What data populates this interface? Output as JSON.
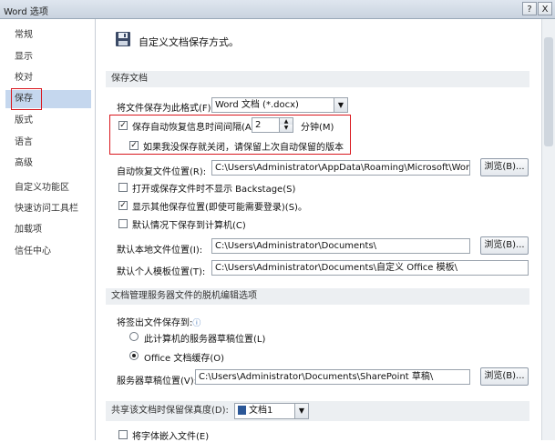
{
  "window": {
    "title": "Word 选项",
    "help_label": "?",
    "close_label": "X"
  },
  "sidebar": {
    "items": [
      {
        "label": "常规"
      },
      {
        "label": "显示"
      },
      {
        "label": "校对"
      },
      {
        "label": "保存"
      },
      {
        "label": "版式"
      },
      {
        "label": "语言"
      },
      {
        "label": "高级"
      },
      {
        "label": "自定义功能区"
      },
      {
        "label": "快速访问工具栏"
      },
      {
        "label": "加载项"
      },
      {
        "label": "信任中心"
      }
    ],
    "active": "保存"
  },
  "header": {
    "title": "自定义文档保存方式。"
  },
  "save_docs": {
    "section_title": "保存文档",
    "format_label": "将文件保存为此格式(F):",
    "format_value": "Word 文档 (*.docx)",
    "autorecover_label": "保存自动恢复信息时间间隔(A)",
    "autorecover_value": "2",
    "minutes_label": "分钟(M)",
    "keep_last_label": "如果我没保存就关闭，请保留上次自动保留的版本",
    "autorecover_path_label": "自动恢复文件位置(R):",
    "autorecover_path_value": "C:\\Users\\Administrator\\AppData\\Roaming\\Microsoft\\Word\\",
    "browse_label": "浏览(B)...",
    "no_backstage_label": "打开或保存文件时不显示 Backstage(S)",
    "show_additional_label": "显示其他保存位置(即使可能需要登录)(S)。",
    "save_to_computer_label": "默认情况下保存到计算机(C)",
    "default_local_label": "默认本地文件位置(I):",
    "default_local_value": "C:\\Users\\Administrator\\Documents\\",
    "personal_template_label": "默认个人模板位置(T):",
    "personal_template_value": "C:\\Users\\Administrator\\Documents\\自定义 Office 模板\\"
  },
  "offline": {
    "section_title": "文档管理服务器文件的脱机编辑选项",
    "save_checkout_label": "将签出文件保存到:",
    "option_server": "此计算机的服务器草稿位置(L)",
    "option_cache": "Office 文档缓存(O)",
    "server_drafts_label": "服务器草稿位置(V):",
    "server_drafts_value": "C:\\Users\\Administrator\\Documents\\SharePoint 草稿\\",
    "browse_label": "浏览(B)..."
  },
  "fidelity": {
    "section_title": "共享该文档时保留保真度(D):",
    "doc_value": "文档1",
    "embed_fonts_label": "将字体嵌入文件(E)"
  },
  "colors": {
    "highlight": "#d9161d",
    "active_bg": "#c5d7ee"
  }
}
